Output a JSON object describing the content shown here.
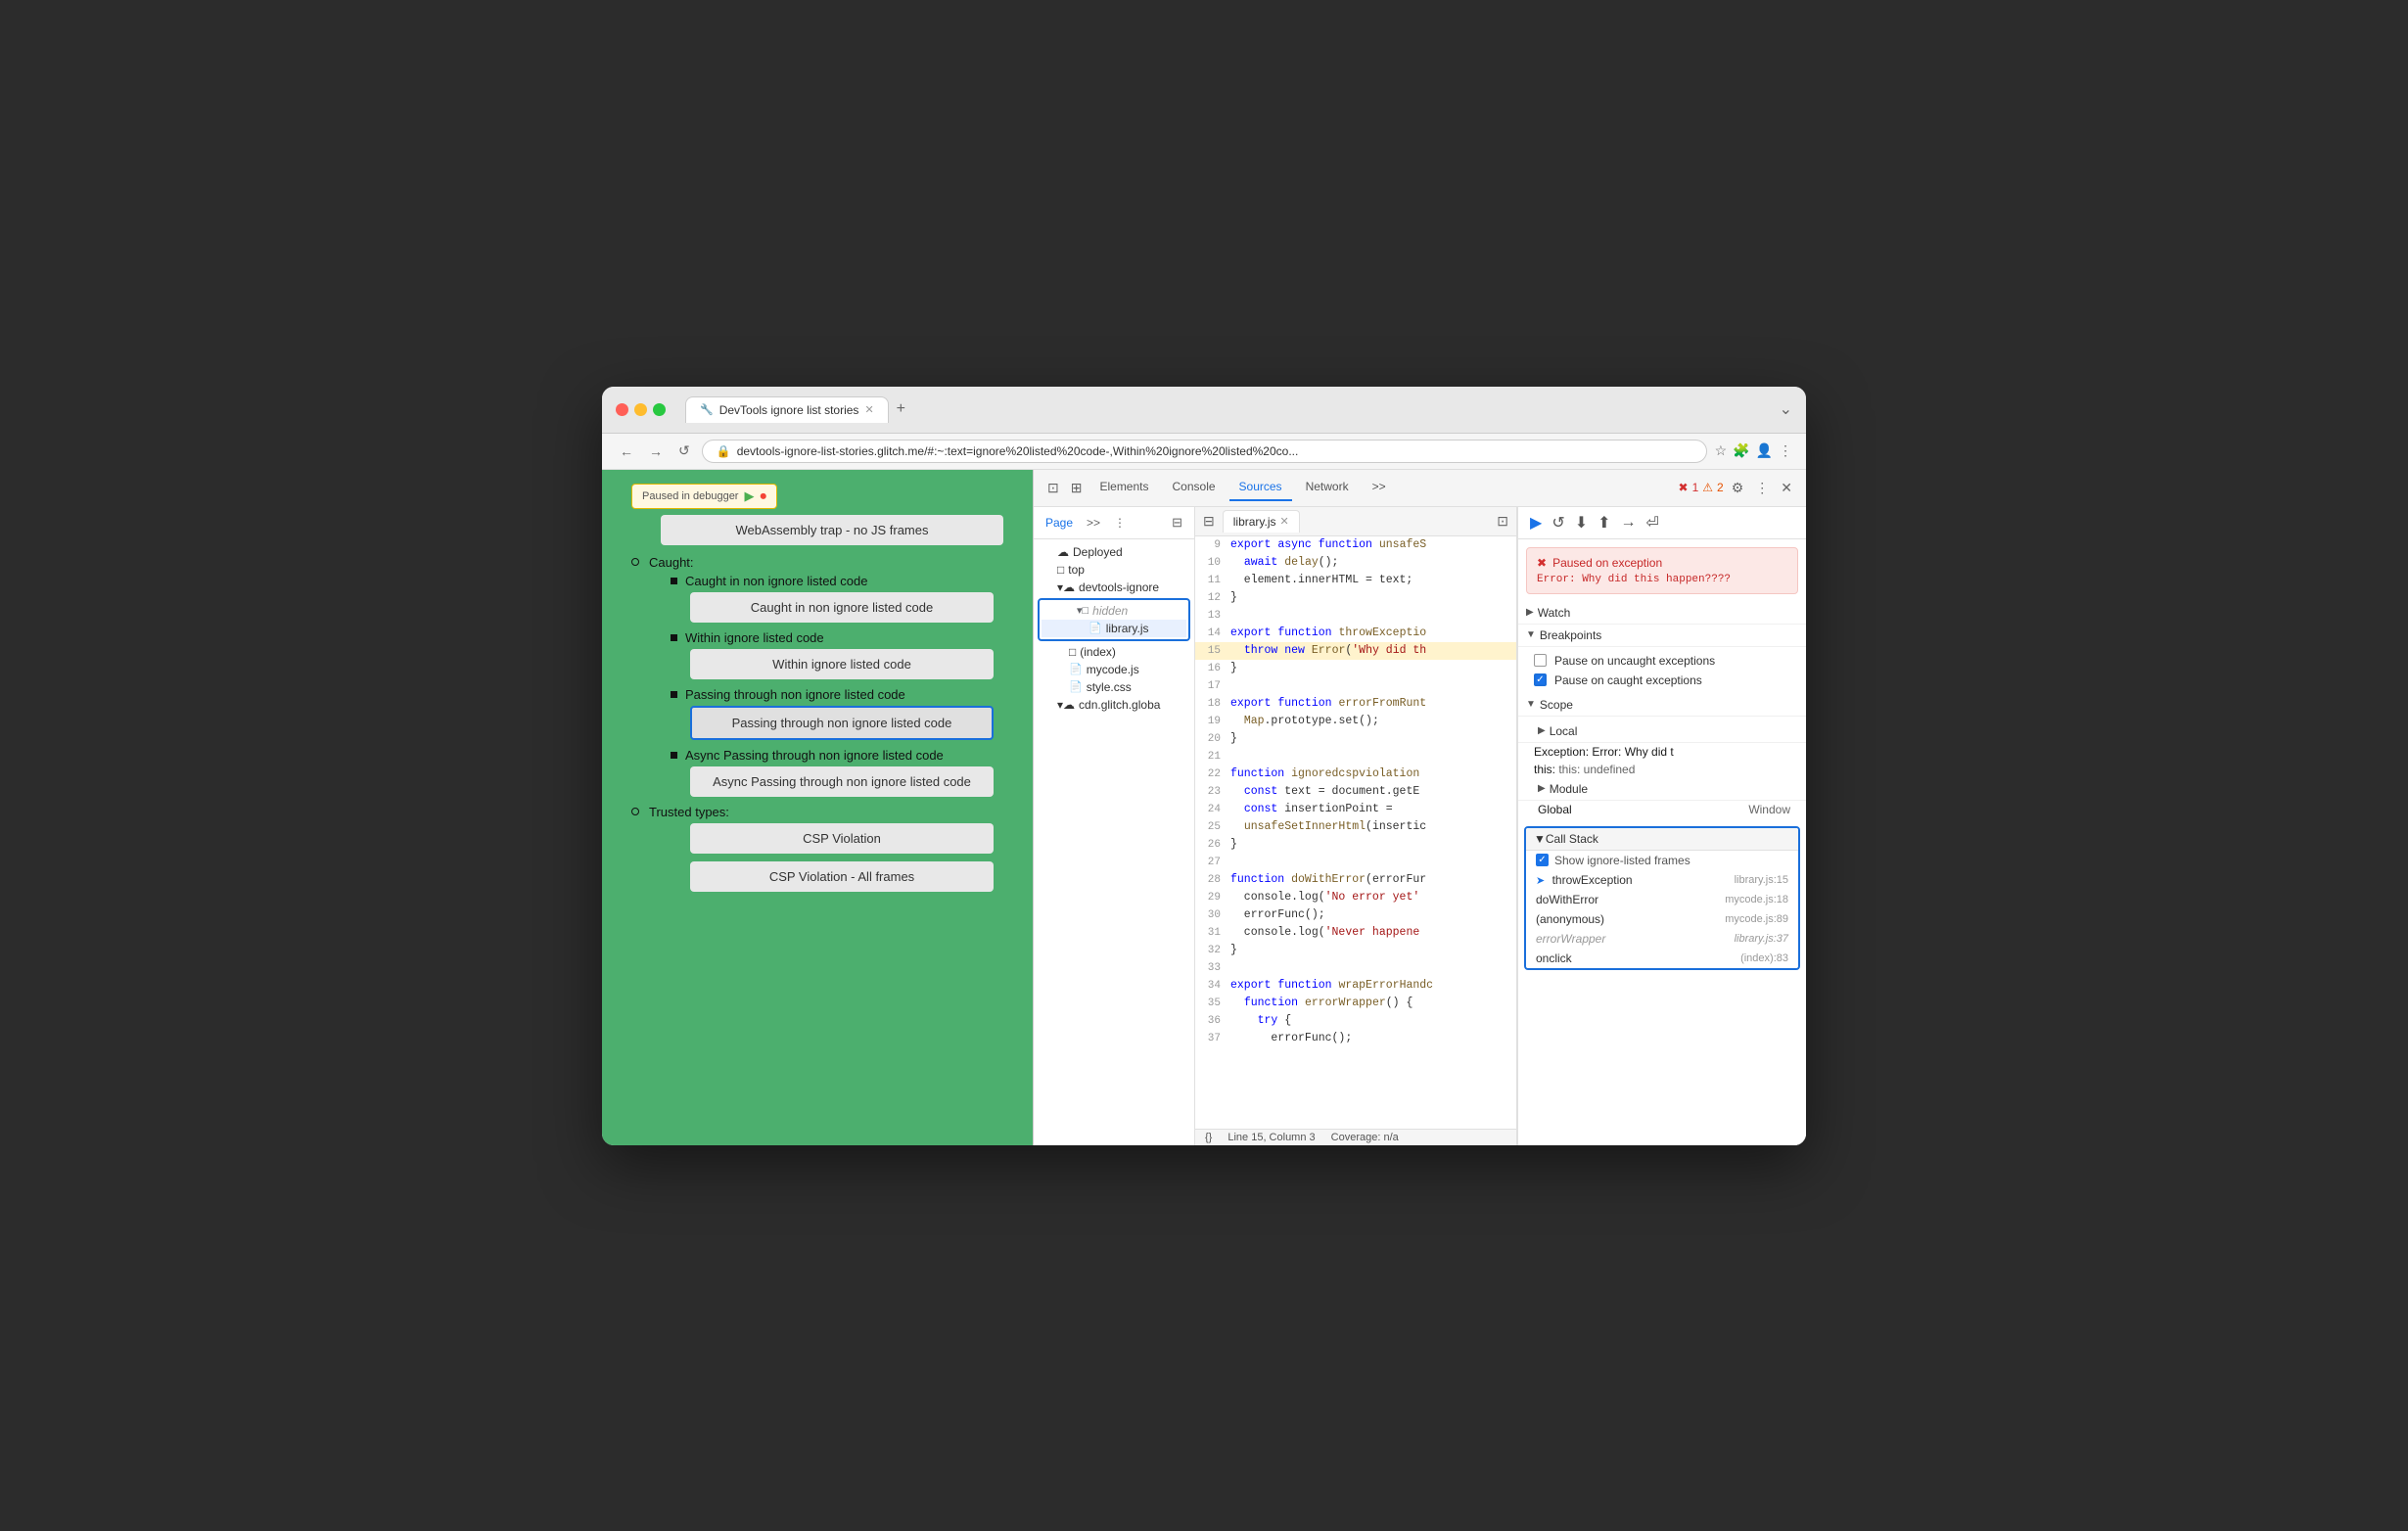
{
  "browser": {
    "tab_title": "DevTools ignore list stories",
    "tab_favicon": "🔧",
    "url": "devtools-ignore-list-stories.glitch.me/#:~:text=ignore%20listed%20code-,Within%20ignore%20listed%20co...",
    "new_tab_label": "+",
    "nav": {
      "back": "←",
      "forward": "→",
      "reload": "↺"
    }
  },
  "webpage": {
    "paused_badge": "Paused in debugger",
    "webassembly_box": "WebAssembly trap - no JS frames",
    "caught_section": "Caught:",
    "items": [
      {
        "label": "Caught in non ignore listed code",
        "box": "Caught in non ignore\nlisted code"
      },
      {
        "label": "Within ignore listed code",
        "box": "Within ignore listed\ncode"
      },
      {
        "label": "Passing through non ignore listed code",
        "box": "Passing through non\nignore listed code",
        "highlighted": true
      },
      {
        "label": "Async Passing through non ignore listed code",
        "box": "Async Passing\nthrough non ignore\nlisted code"
      }
    ],
    "trusted_types_title": "Trusted types:",
    "trusted_types_items": [
      "CSP Violation",
      "CSP Violation - All frames"
    ]
  },
  "devtools": {
    "tabs": [
      "Elements",
      "Console",
      "Sources",
      "Network"
    ],
    "active_tab": "Sources",
    "more_tabs": ">>",
    "error_count": "1",
    "warning_count": "2",
    "top_icons": [
      "⚙",
      "⋮",
      "✕"
    ],
    "sources": {
      "title": "Sources",
      "nav_items": [
        "Page",
        ">>",
        "⋮"
      ],
      "file_tree": {
        "deployed": "Deployed",
        "top": "top",
        "devtools_ignore": "devtools-ignore",
        "hidden": "hidden",
        "library_js": "library.js",
        "index": "(index)",
        "mycode_js": "mycode.js",
        "style_css": "style.css",
        "cdn_glitch": "cdn.glitch.globa"
      }
    },
    "editor": {
      "tab_name": "library.js",
      "lines": [
        {
          "num": "9",
          "content": "export async function unsafeS",
          "highlight": false
        },
        {
          "num": "10",
          "content": "  await delay();",
          "highlight": false
        },
        {
          "num": "11",
          "content": "  element.innerHTML = text;",
          "highlight": false
        },
        {
          "num": "12",
          "content": "}",
          "highlight": false
        },
        {
          "num": "13",
          "content": "",
          "highlight": false
        },
        {
          "num": "14",
          "content": "export function throwExceptio",
          "highlight": false
        },
        {
          "num": "15",
          "content": "  throw new Error('Why did th",
          "highlight": true
        },
        {
          "num": "16",
          "content": "}",
          "highlight": false
        },
        {
          "num": "17",
          "content": "",
          "highlight": false
        },
        {
          "num": "18",
          "content": "export function errorFromRunt",
          "highlight": false
        },
        {
          "num": "19",
          "content": "  Map.prototype.set();",
          "highlight": false
        },
        {
          "num": "20",
          "content": "}",
          "highlight": false
        },
        {
          "num": "21",
          "content": "",
          "highlight": false
        },
        {
          "num": "22",
          "content": "function ignoredcspviolation",
          "highlight": false
        },
        {
          "num": "23",
          "content": "  const text = document.getE",
          "highlight": false
        },
        {
          "num": "24",
          "content": "  const insertionPoint =",
          "highlight": false
        },
        {
          "num": "25",
          "content": "  unsafeSetInnerHtml(insertic",
          "highlight": false
        },
        {
          "num": "26",
          "content": "}",
          "highlight": false
        },
        {
          "num": "27",
          "content": "",
          "highlight": false
        },
        {
          "num": "28",
          "content": "function doWithError(errorFur",
          "highlight": false
        },
        {
          "num": "29",
          "content": "  console.log('No error yet'",
          "highlight": false
        },
        {
          "num": "30",
          "content": "  errorFunc();",
          "highlight": false
        },
        {
          "num": "31",
          "content": "  console.log('Never happene",
          "highlight": false
        },
        {
          "num": "32",
          "content": "}",
          "highlight": false
        },
        {
          "num": "33",
          "content": "",
          "highlight": false
        },
        {
          "num": "34",
          "content": "export function wrapErrorHanc",
          "highlight": false
        },
        {
          "num": "35",
          "content": "  function errorWrapper() {",
          "highlight": false
        },
        {
          "num": "36",
          "content": "    try {",
          "highlight": false
        },
        {
          "num": "37",
          "content": "      errorFunc();",
          "highlight": false
        }
      ],
      "status_line": "Line 15, Column 3",
      "coverage": "Coverage: n/a"
    },
    "debugger": {
      "toolbar_btns": [
        "▶",
        "↺",
        "⬇",
        "⬆",
        "→",
        "⏎"
      ],
      "exception": {
        "title": "Paused on exception",
        "message": "Error: Why did this\nhappen????"
      },
      "sections": {
        "watch": "Watch",
        "breakpoints": "Breakpoints",
        "pause_uncaught": "Pause on uncaught exceptions",
        "pause_caught": "Pause on caught exceptions",
        "scope": "Scope",
        "local": "Local",
        "exception_var": "Exception: Error: Why did t",
        "this_val": "this: undefined",
        "module": "Module",
        "global": "Global",
        "global_val": "Window",
        "call_stack": "Call Stack",
        "show_ignore_frames": "Show ignore-listed frames"
      },
      "stack_frames": [
        {
          "name": "throwException",
          "loc": "library.js:15",
          "arrow": true,
          "ignore": false
        },
        {
          "name": "doWithError",
          "loc": "mycode.js:18",
          "arrow": false,
          "ignore": false
        },
        {
          "name": "(anonymous)",
          "loc": "mycode.js:89",
          "arrow": false,
          "ignore": false
        },
        {
          "name": "errorWrapper",
          "loc": "library.js:37",
          "arrow": false,
          "ignore": true
        },
        {
          "name": "onclick",
          "loc": "(index):83",
          "arrow": false,
          "ignore": false
        }
      ]
    }
  }
}
